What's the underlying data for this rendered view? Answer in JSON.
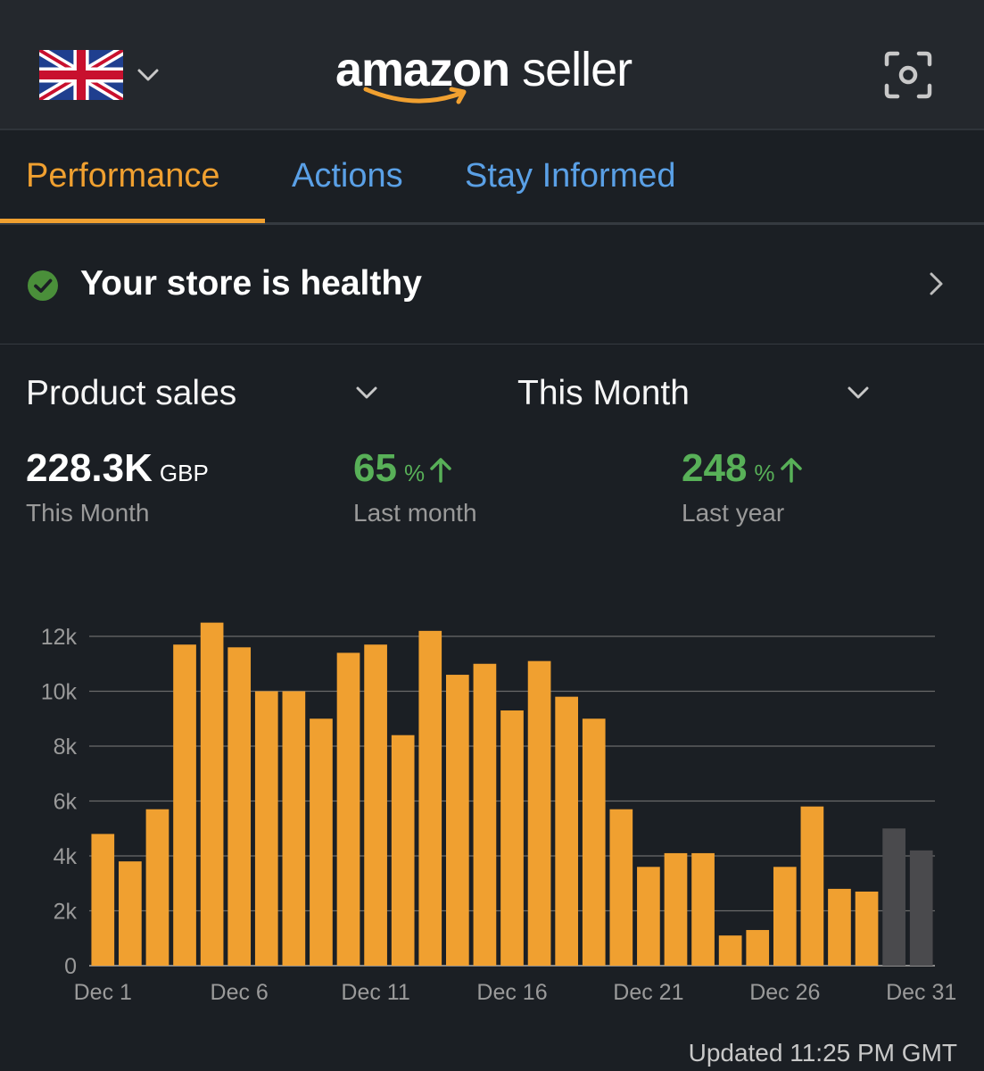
{
  "header": {
    "country_flag_icon": "uk-flag-icon",
    "logo": {
      "brand": "amazon",
      "product": "seller"
    },
    "scan_icon": "camera-scan-icon"
  },
  "tabs": [
    {
      "label": "Performance",
      "active": true
    },
    {
      "label": "Actions",
      "active": false
    },
    {
      "label": "Stay Informed",
      "active": false
    }
  ],
  "health": {
    "text": "Your store is healthy",
    "status_color": "#4a8f3a"
  },
  "selectors": {
    "metric": "Product sales",
    "period": "This Month"
  },
  "metrics": {
    "total": {
      "value": "228.3K",
      "unit": "GBP",
      "label": "This Month"
    },
    "vs_last_month": {
      "value": "65",
      "unit": "%",
      "label": "Last month"
    },
    "vs_last_year": {
      "value": "248",
      "unit": "%",
      "label": "Last year"
    }
  },
  "colors": {
    "accent": "#f0a030",
    "link": "#5aa0e6",
    "positive": "#58b058",
    "projected": "#4a4a4d"
  },
  "chart_data": {
    "type": "bar",
    "categories": [
      "Dec 1",
      "Dec 2",
      "Dec 3",
      "Dec 4",
      "Dec 5",
      "Dec 6",
      "Dec 7",
      "Dec 8",
      "Dec 9",
      "Dec 10",
      "Dec 11",
      "Dec 12",
      "Dec 13",
      "Dec 14",
      "Dec 15",
      "Dec 16",
      "Dec 17",
      "Dec 18",
      "Dec 19",
      "Dec 20",
      "Dec 21",
      "Dec 22",
      "Dec 23",
      "Dec 24",
      "Dec 25",
      "Dec 26",
      "Dec 27",
      "Dec 28",
      "Dec 29",
      "Dec 30",
      "Dec 31"
    ],
    "values": [
      4800,
      3800,
      5700,
      11700,
      12500,
      11600,
      10000,
      10000,
      9000,
      11400,
      11700,
      8400,
      12200,
      10600,
      11000,
      9300,
      11100,
      9800,
      9000,
      5700,
      3600,
      4100,
      4100,
      1100,
      1300,
      3600,
      5800,
      2800,
      2700,
      5000,
      4200
    ],
    "projected": [
      false,
      false,
      false,
      false,
      false,
      false,
      false,
      false,
      false,
      false,
      false,
      false,
      false,
      false,
      false,
      false,
      false,
      false,
      false,
      false,
      false,
      false,
      false,
      false,
      false,
      false,
      false,
      false,
      false,
      true,
      true
    ],
    "x_tick_labels": [
      "Dec 1",
      "Dec 6",
      "Dec 11",
      "Dec 16",
      "Dec 21",
      "Dec 26",
      "Dec 31"
    ],
    "y_tick_labels": [
      "0",
      "2k",
      "4k",
      "6k",
      "8k",
      "10k",
      "12k"
    ],
    "y_ticks": [
      0,
      2000,
      4000,
      6000,
      8000,
      10000,
      12000
    ],
    "ylim": [
      0,
      12000
    ],
    "grid": true
  },
  "footer": {
    "updated": "Updated 11:25 PM GMT"
  }
}
